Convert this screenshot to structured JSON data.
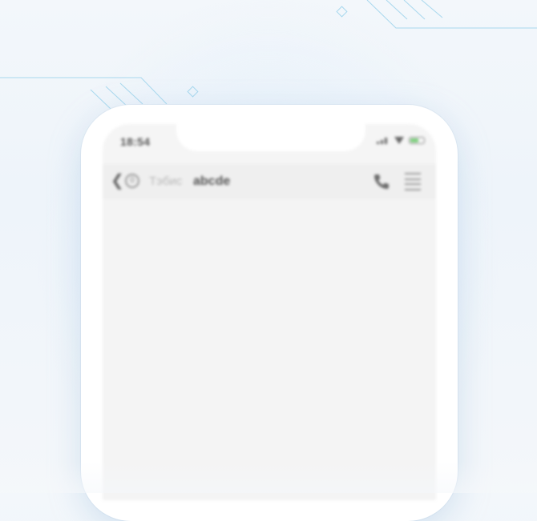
{
  "status_bar": {
    "time": "18:54",
    "signal_icon": "signal-icon",
    "wifi_icon": "wifi-icon",
    "battery_icon": "battery-icon",
    "battery_color": "#7ccf7c"
  },
  "chat_header": {
    "back_icon": "chevron-left-icon",
    "unread_badge": "0",
    "contact_subtitle": "Тэбис",
    "contact_name": "abcde",
    "call_icon": "phone-icon",
    "menu_icon": "menu-icon"
  },
  "colors": {
    "background": "#eef4fa",
    "device": "#ffffff",
    "screen": "#f5f5f5",
    "header": "#efefef",
    "deco_line": "#9fd3ea"
  }
}
